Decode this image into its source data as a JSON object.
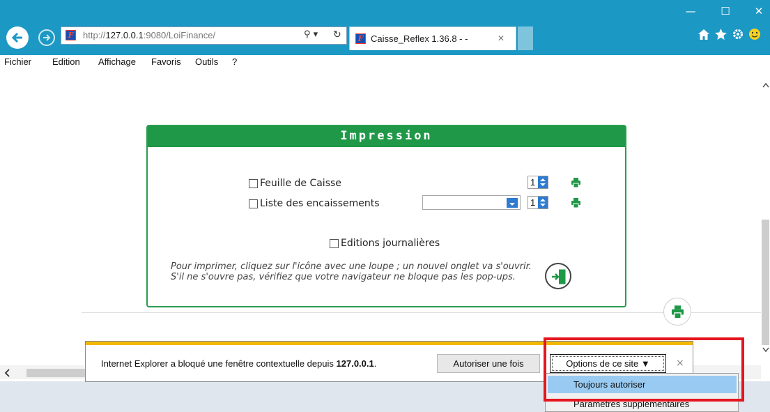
{
  "browser": {
    "url_prefix": "http://",
    "url_host": "127.0.0.1",
    "url_rest": ":9080/LoiFinance/",
    "tab_title": "Caisse_Reflex 1.36.8 - -",
    "search_glyph": "⚲ ▾",
    "refresh_glyph": "↻",
    "close_tab_glyph": "✕",
    "window_controls": {
      "minimize": "—",
      "maximize": "☐",
      "close": "✕"
    },
    "toolbar_icons": [
      "home-icon",
      "favorites-star-icon",
      "settings-gear-icon",
      "smiley-feedback-icon"
    ],
    "accent_color": "#1c98c4"
  },
  "menu": {
    "items": [
      "Fichier",
      "Edition",
      "Affichage",
      "Favoris",
      "Outils",
      "?"
    ]
  },
  "panel": {
    "title": "Impression",
    "accent_color": "#1f9847",
    "rows": [
      {
        "label": "Feuille de Caisse",
        "copies": "1",
        "checked": false
      },
      {
        "label": "Liste des encaissements",
        "copies": "1",
        "checked": false,
        "select_value": ""
      }
    ],
    "daily": {
      "label": "Editions journalières",
      "checked": false
    },
    "hint": "Pour imprimer, cliquez sur l'icône avec une loupe ; un nouvel onglet va s'ouvrir. S'il ne s'ouvre pas, vérifiez que votre navigateur ne bloque pas les pop-ups."
  },
  "popup": {
    "message_start": "Internet Explorer a bloqué une fenêtre contextuelle depuis ",
    "message_host": "127.0.0.1",
    "message_end": ".",
    "allow_once": "Autoriser une fois",
    "site_options": "Options de ce site ▼",
    "close_glyph": "×",
    "accent_color": "#f2b800"
  },
  "dropdown": {
    "items": [
      "Toujours autoriser",
      "Paramètres supplémentaires"
    ],
    "highlighted_index": 0
  },
  "annotation_color": "#e5161f"
}
